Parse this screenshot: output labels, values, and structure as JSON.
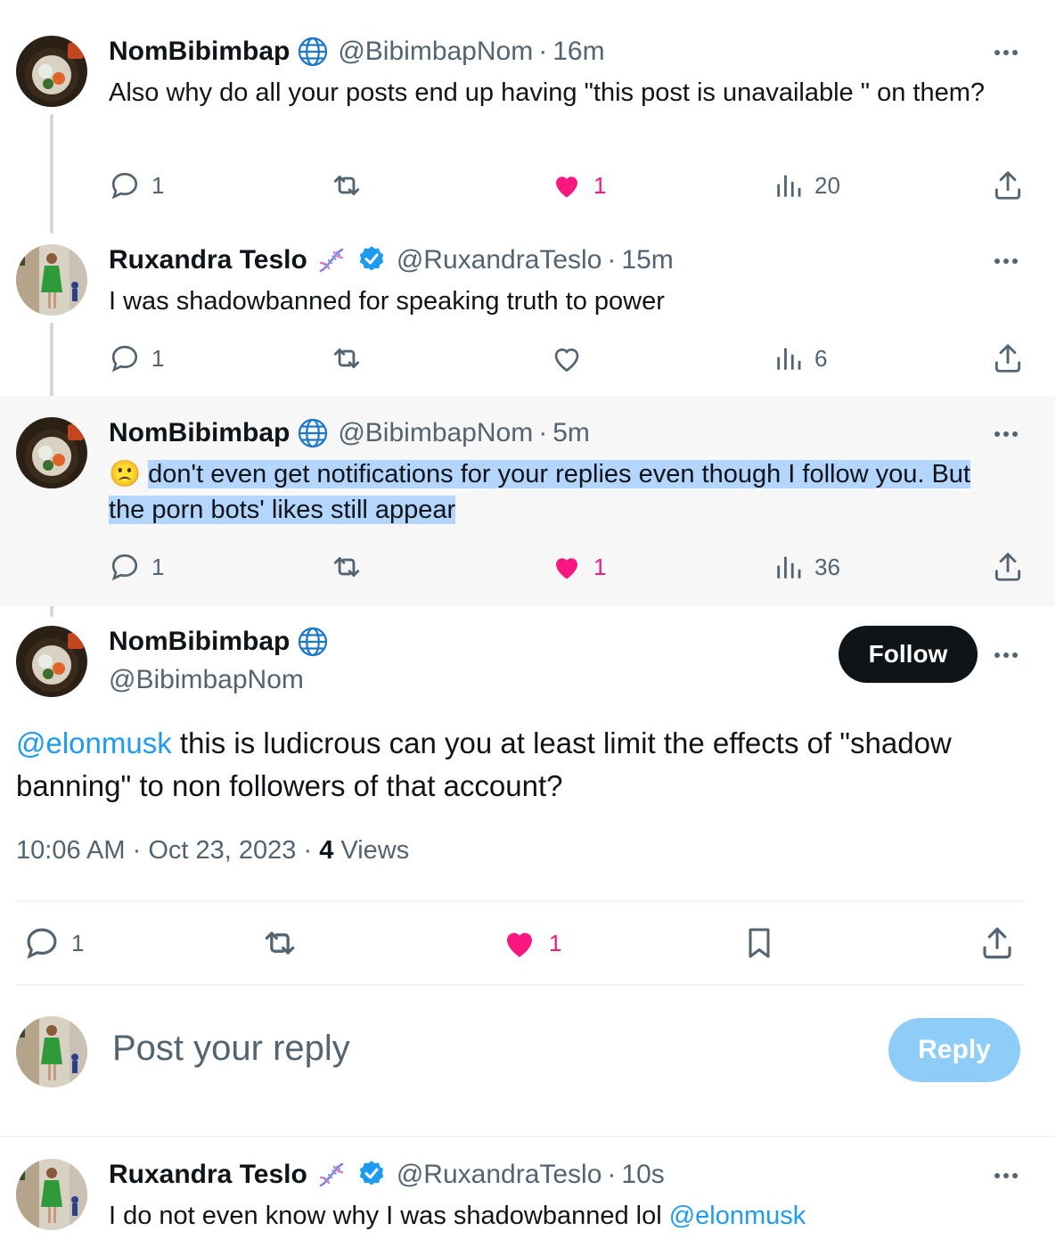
{
  "posts": [
    {
      "name": "NomBibimbap",
      "handle": "@BibimbapNom",
      "time": "16m",
      "text": "Also why do all your posts end up having \"this post is unavailable \" on them?",
      "replies": "1",
      "likes": "1",
      "views": "20"
    },
    {
      "name": "Ruxandra Teslo",
      "handle": "@RuxandraTeslo",
      "time": "15m",
      "text": "I was shadowbanned for speaking truth to power",
      "replies": "1",
      "views": "6"
    },
    {
      "name": "NomBibimbap",
      "handle": "@BibimbapNom",
      "time": "5m",
      "emoji": "🙁",
      "text_selected": "don't even get notifications for your replies even though I follow you. But the porn bots' likes still appear",
      "replies": "1",
      "likes": "1",
      "views": "36"
    }
  ],
  "main_post": {
    "name": "NomBibimbap",
    "handle": "@BibimbapNom",
    "follow_label": "Follow",
    "mention": "@elonmusk",
    "text": " this is ludicrous can you at least limit the effects of \"shadow banning\" to non followers of that account?",
    "time": "10:06 AM",
    "date": "Oct 23, 2023",
    "views_count": "4",
    "views_label": "Views",
    "replies": "1",
    "likes": "1"
  },
  "reply_box": {
    "placeholder": "Post your reply",
    "button_label": "Reply"
  },
  "last_post": {
    "name": "Ruxandra Teslo",
    "handle": "@RuxandraTeslo",
    "time": "10s",
    "text": "I do not even know why I was shadowbanned lol ",
    "mention": "@elonmusk"
  },
  "separator": "·",
  "colors": {
    "accent": "#1d9bf0",
    "like": "#f91880",
    "muted": "#536471",
    "highlight": "#b4d5fe"
  }
}
